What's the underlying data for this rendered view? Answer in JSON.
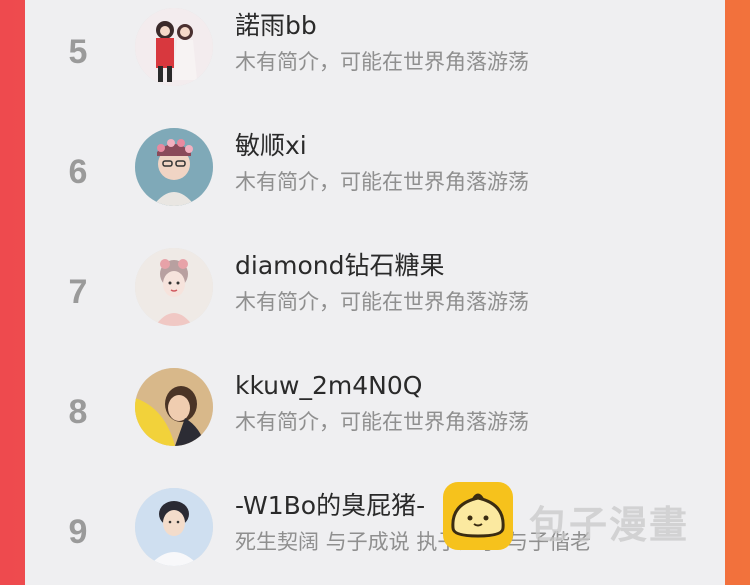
{
  "users": [
    {
      "rank": "5",
      "name": "諾雨bb",
      "bio": "木有简介，可能在世界角落游荡",
      "avatar_icon": "avatar-couple-illustration"
    },
    {
      "rank": "6",
      "name": "敏顺xi",
      "bio": "木有简介，可能在世界角落游荡",
      "avatar_icon": "avatar-boy-flower-crown"
    },
    {
      "rank": "7",
      "name": "diamond钻石糖果",
      "bio": "木有简介，可能在世界角落游荡",
      "avatar_icon": "avatar-girl-illustration"
    },
    {
      "rank": "8",
      "name": "kkuw_2m4N0Q",
      "bio": "木有简介，可能在世界角落游荡",
      "avatar_icon": "avatar-girl-yellow"
    },
    {
      "rank": "9",
      "name": "-W1Bo的臭屁猪-",
      "bio": "死生契阔 与子成说 执子之手 与子偕老",
      "avatar_icon": "avatar-boy-photo"
    }
  ],
  "watermark": {
    "text": "包子漫畫",
    "icon": "baozi-logo-icon"
  },
  "colors": {
    "background_left": "#ee4a4e",
    "background_right": "#f2723c",
    "panel": "#efeff1",
    "rank": "#9a9a9a",
    "name": "#2a2a2a",
    "bio": "#8f8f8f",
    "logo": "#f6c21c"
  }
}
